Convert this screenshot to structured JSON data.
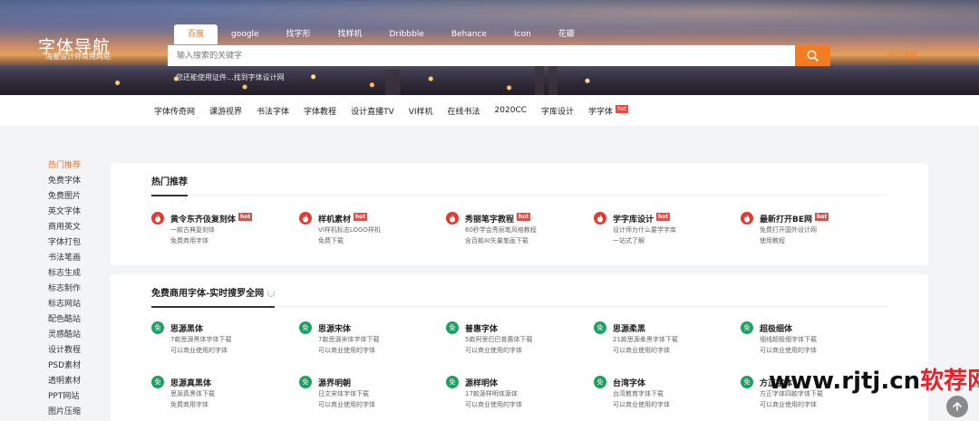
{
  "hero": {
    "logo_title": "字体导航",
    "logo_subtitle": "海量设计师常用网站",
    "engine_tabs": [
      "百度",
      "google",
      "找字形",
      "找样机",
      "Dribbble",
      "Behance",
      "Icon",
      "花瓣"
    ],
    "active_tab": "百度",
    "search_placeholder": "输入搜索的关键字",
    "hint": "您还能使用证件...找到字体设计网",
    "right_link": "设计导航"
  },
  "nav": {
    "items": [
      "字体传奇网",
      "课游视界",
      "书法字体",
      "字体教程",
      "设计直播TV",
      "VI样机",
      "在线书法",
      "2020CC",
      "字库设计",
      "学字体"
    ],
    "hot_badge": "hot"
  },
  "sidebar": {
    "items": [
      "热门推荐",
      "免费字体",
      "免费图片",
      "英文字体",
      "商用英文",
      "字体打包",
      "书法笔画",
      "标志生成",
      "标志制作",
      "标志网站",
      "配色酷站",
      "灵感酷站",
      "设计教程",
      "PSD素材",
      "透明素材",
      "PPT网站",
      "图片压缩"
    ],
    "active": "热门推荐"
  },
  "hot": {
    "title": "热门推荐",
    "items": [
      {
        "name": "黄令东齐伋复刻体",
        "d1": "一款古典复刻体",
        "d2": "免费商用字体",
        "badge": "hot"
      },
      {
        "name": "样机素材",
        "d1": "VI样机标志LOGO样机",
        "d2": "免费下载",
        "badge": "hot"
      },
      {
        "name": "秀丽笔字教程",
        "d1": "60秒学会秀丽笔风格教程",
        "d2": "含百款AI矢量笔画下载",
        "badge": "hot"
      },
      {
        "name": "学字库设计",
        "d1": "设计师为什么要学字库",
        "d2": "一站式了解",
        "badge": "hot"
      },
      {
        "name": "最新打开BE网",
        "d1": "免费打开国外设计网",
        "d2": "使用教程",
        "badge": "hot"
      }
    ]
  },
  "free": {
    "title": "免费商用字体-实时搜罗全网",
    "items": [
      {
        "name": "思源黑体",
        "d1": "7款思源黑体字体下载",
        "d2": "可以商业使用的字体"
      },
      {
        "name": "思源宋体",
        "d1": "7款思源宋体字体下载",
        "d2": "可以商业使用的字体"
      },
      {
        "name": "普惠字体",
        "d1": "5款阿里巴巴普惠体下载",
        "d2": "可以商业使用的字体"
      },
      {
        "name": "思源柔黑",
        "d1": "21款思源柔黑字体下载",
        "d2": "可以商业使用的字体"
      },
      {
        "name": "超极细体",
        "d1": "细线超极细字体下载",
        "d2": "可以商业使用的字体"
      },
      {
        "name": "思源真黑体",
        "d1": "思源真黑体下载",
        "d2": "免费商用字体"
      },
      {
        "name": "源界明朝",
        "d1": "日文宋体字体下载",
        "d2": "可以商业使用的字体"
      },
      {
        "name": "源样明体",
        "d1": "17款源样明体源体",
        "d2": "可以商业使用的字体"
      },
      {
        "name": "台湾字体",
        "d1": "台湾教育字体下载",
        "d2": "可以商业使用的字体"
      },
      {
        "name": "方正字体",
        "d1": "方正字体四款字体下载",
        "d2": "可以商业使用的字体"
      }
    ],
    "free_badge": "免"
  },
  "watermark": {
    "domain": "www.rjtj.cn",
    "brand": "软荐网"
  },
  "colors": {
    "accent": "#f37b22",
    "hot": "#e53a2f",
    "free": "#1aa260"
  }
}
